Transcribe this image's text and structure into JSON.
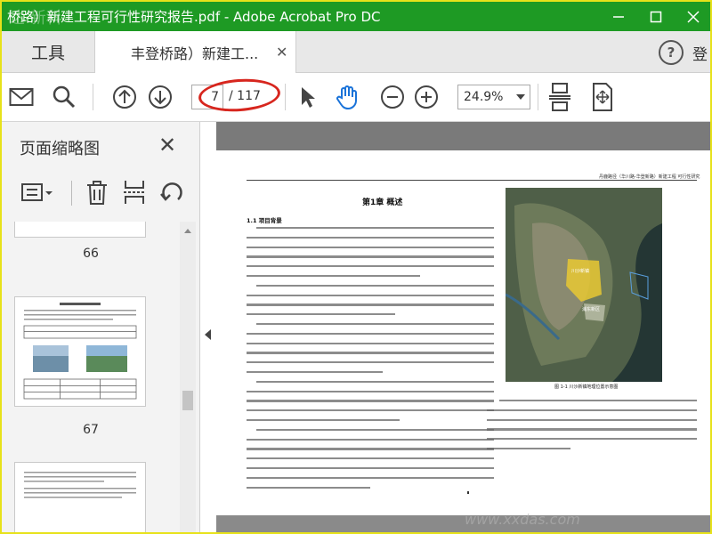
{
  "window": {
    "title": "桥路）新建工程可行性研究报告.pdf - Adobe Acrobat Pro DC",
    "watermark_top": "达·新科",
    "watermark_bottom": "www.xxdas.com"
  },
  "tabs": {
    "tools_label": "工具",
    "doc_label": "丰登桥路）新建工...",
    "login_label": "登"
  },
  "toolbar": {
    "current_page": "7",
    "total_pages": "/ 117",
    "zoom": "24.9%"
  },
  "panel": {
    "title": "页面缩略图",
    "thumbnails": [
      {
        "label": "66"
      },
      {
        "label": "67"
      }
    ]
  },
  "document": {
    "header": "丹鹿路径（华川路-华登新路）新建工程 可行性研究",
    "chapter": "第1章 概述",
    "section": "1.1 项目背景",
    "map_caption": "图 1-1 川沙新镇地理位置示意图"
  },
  "colors": {
    "titlebar": "#1e9a24",
    "highlight": "#d7261e",
    "accent_blue": "#1a73d9"
  }
}
